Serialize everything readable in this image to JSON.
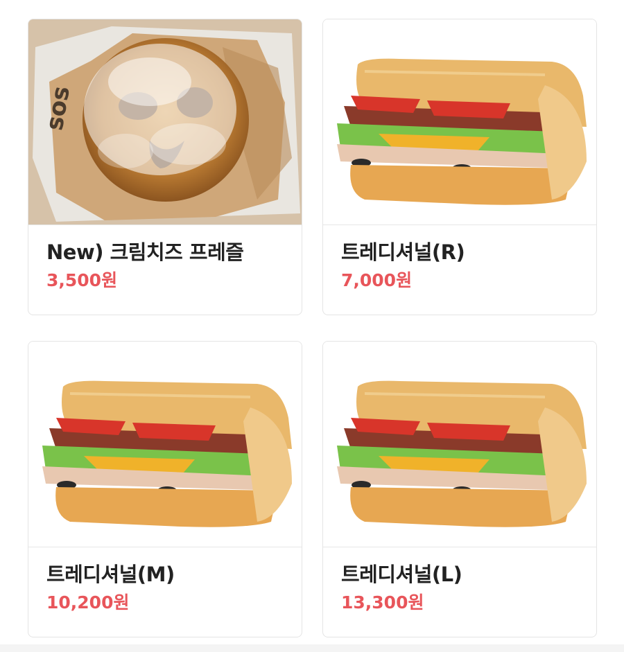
{
  "menu": {
    "items": [
      {
        "name": "New) 크림치즈 프레즐",
        "price": "3,500원",
        "image": "pretzel"
      },
      {
        "name": "트레디셔널(R)",
        "price": "7,000원",
        "image": "sandwich"
      },
      {
        "name": "트레디셔널(M)",
        "price": "10,200원",
        "image": "sandwich"
      },
      {
        "name": "트레디셔널(L)",
        "price": "13,300원",
        "image": "sandwich"
      }
    ]
  },
  "colors": {
    "price": "#e8555a",
    "name": "#222222",
    "border": "#e4e4e4"
  }
}
